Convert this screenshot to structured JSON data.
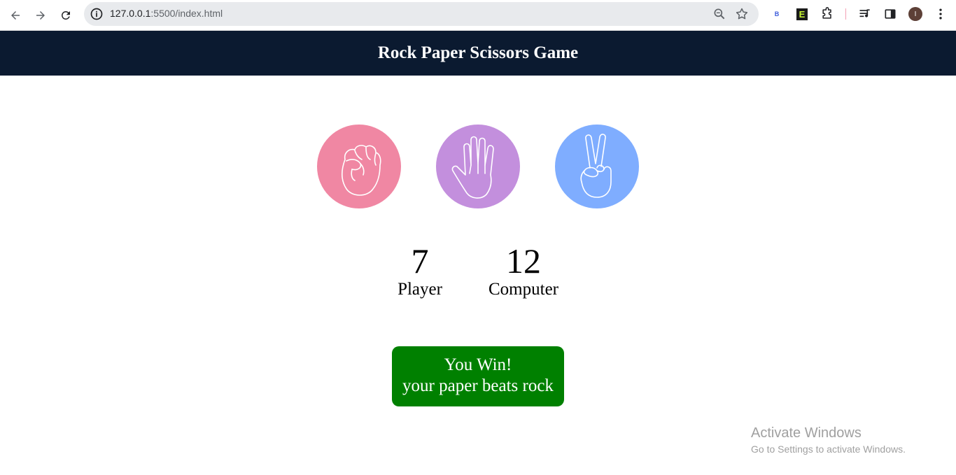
{
  "browser": {
    "url_host": "127.0.0.1",
    "url_rest": ":5500/index.html",
    "avatar_letter": "I",
    "extension_b_label": "B",
    "extension_e_label": "E"
  },
  "page": {
    "title": "Rock Paper Scissors Game"
  },
  "choices": [
    {
      "name": "rock",
      "icon": "fist-icon",
      "color": "#f087a3"
    },
    {
      "name": "paper",
      "icon": "open-hand-icon",
      "color": "#c38fdd"
    },
    {
      "name": "scissors",
      "icon": "peace-hand-icon",
      "color": "#7fadff"
    }
  ],
  "scores": {
    "player_value": "7",
    "player_label": "Player",
    "computer_value": "12",
    "computer_label": "Computer"
  },
  "result": {
    "line1": "You Win!",
    "line2": "your paper beats rock",
    "color": "#008000"
  },
  "watermark": {
    "line1": "Activate Windows",
    "line2": "Go to Settings to activate Windows."
  }
}
